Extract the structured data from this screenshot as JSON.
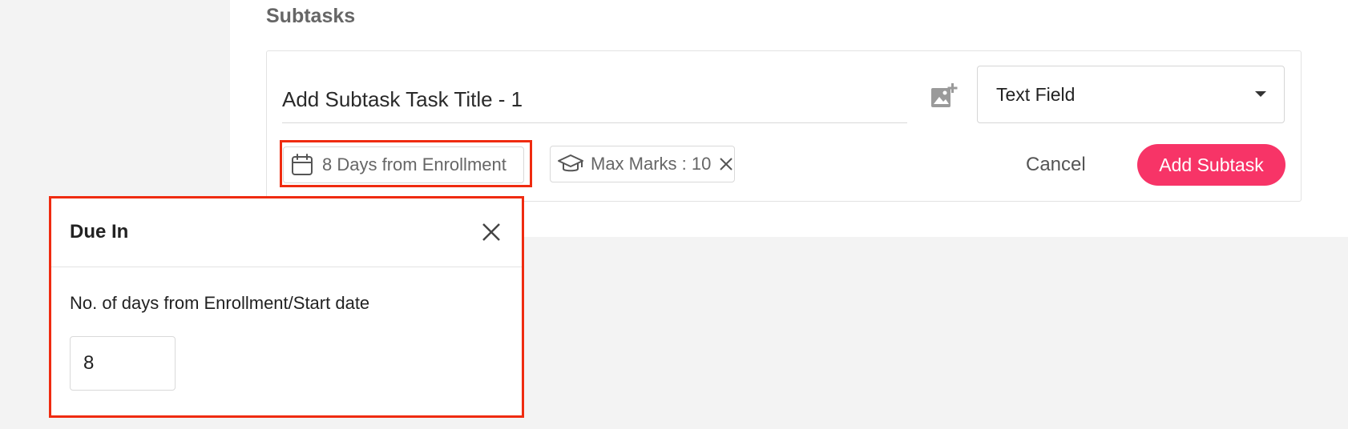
{
  "section": {
    "title": "Subtasks"
  },
  "subtask": {
    "title_placeholder": "Add Subtask Task Title - 1",
    "add_image_icon": "add-image-icon",
    "field_type": {
      "selected": "Text Field"
    },
    "due_chip": {
      "label": "8 Days from Enrollment",
      "icon": "calendar-icon"
    },
    "marks_chip": {
      "label": "Max Marks : 10",
      "icon": "graduation-cap-icon"
    },
    "cancel_label": "Cancel",
    "add_label": "Add Subtask"
  },
  "due_popup": {
    "title": "Due In",
    "field_label": "No. of days from Enrollment/Start date",
    "days_value": "8"
  },
  "colors": {
    "accent": "#f73467",
    "highlight": "#ef2b10",
    "background": "#f3f3f3"
  }
}
